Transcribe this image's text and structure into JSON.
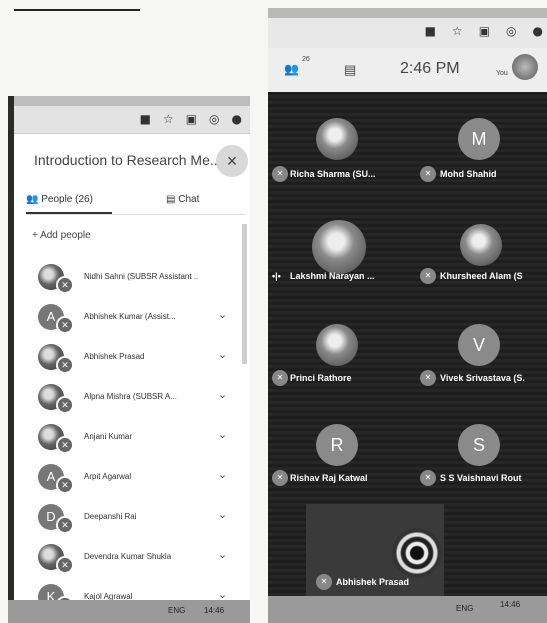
{
  "left_panel": {
    "title": "Introduction to Research Me...",
    "close": "×",
    "tab_people": "People (26)",
    "tab_chat": "Chat",
    "add_people": "Add people",
    "participants": [
      {
        "initial": "",
        "name": "Nidhi Sahni (SUBSR Assistant ..",
        "chevron": ""
      },
      {
        "initial": "A",
        "name": "Abhishek Kumar (Assist...",
        "chevron": "⌄"
      },
      {
        "initial": "",
        "name": "Abhishek Prasad",
        "chevron": "⌄"
      },
      {
        "initial": "",
        "name": "Alpna Mishra (SUBSR A...",
        "chevron": "⌄"
      },
      {
        "initial": "",
        "name": "Anjani Kumar",
        "chevron": "⌄"
      },
      {
        "initial": "A",
        "name": "Arpit Agarwal",
        "chevron": "⌄"
      },
      {
        "initial": "D",
        "name": "Deepanshi Rai",
        "chevron": "⌄"
      },
      {
        "initial": "",
        "name": "Devendra Kumar Shukla",
        "chevron": "⌄"
      },
      {
        "initial": "K",
        "name": "Kajol Agrawal",
        "chevron": "⌄"
      }
    ],
    "taskbar": {
      "lang": "ENG",
      "time": "14:46"
    }
  },
  "right_panel": {
    "people_count": "26",
    "time": "2:46 PM",
    "you_label": "You",
    "tiles": [
      {
        "initial": "",
        "name": "Richa Sharma (SU..."
      },
      {
        "initial": "M",
        "name": "Mohd Shahid"
      },
      {
        "initial": "",
        "name": "Lakshmi Narayan ..."
      },
      {
        "initial": "",
        "name": "Khursheed Alam (S"
      },
      {
        "initial": "",
        "name": "Princi Rathore"
      },
      {
        "initial": "V",
        "name": "Vivek Srivastava (S."
      },
      {
        "initial": "R",
        "name": "Rishav Raj Katwal"
      },
      {
        "initial": "S",
        "name": "S S Vaishnavi Rout"
      }
    ],
    "self_name": "Abhishek Prasad",
    "taskbar": {
      "lang": "ENG",
      "time": "14:46"
    }
  },
  "icons": [
    "camera-icon",
    "star-icon",
    "extension-icon",
    "profile-icon",
    "menu-icon",
    "people-icon",
    "chat-icon",
    "mic-off-icon",
    "close-icon"
  ]
}
